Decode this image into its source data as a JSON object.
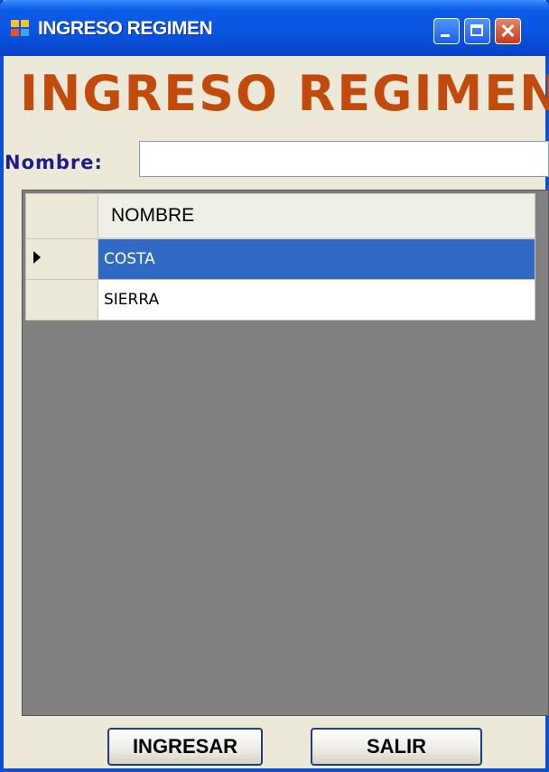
{
  "window": {
    "title": "INGRESO REGIMEN",
    "controls": {
      "minimize": "minimize",
      "maximize": "maximize",
      "close": "✕"
    }
  },
  "heading": "INGRESO REGIMEN",
  "form": {
    "nombre_label": "Nombre:",
    "nombre_value": ""
  },
  "grid": {
    "columns": [
      "NOMBRE"
    ],
    "rows": [
      {
        "nombre": "COSTA",
        "selected": true
      },
      {
        "nombre": "SIERRA",
        "selected": false
      }
    ]
  },
  "buttons": {
    "ingresar": "INGRESAR",
    "salir": "SALIR"
  },
  "colors": {
    "heading": "#c24a0c",
    "label": "#1d1d8a",
    "selection": "#316ac5",
    "grid_background": "#808080",
    "titlebar": "#0a55e0"
  }
}
